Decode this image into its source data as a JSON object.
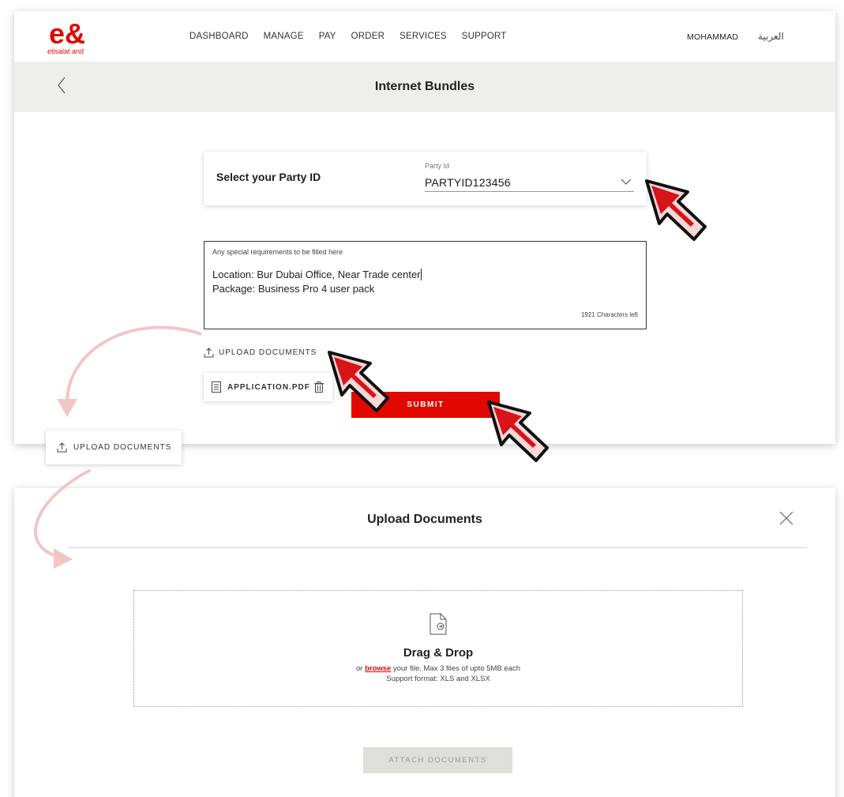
{
  "brand": {
    "logo_text": "e&",
    "sub": "etisalat and",
    "accent_color": "#e00800"
  },
  "nav": {
    "items": [
      "DASHBOARD",
      "MANAGE",
      "PAY",
      "ORDER",
      "SERVICES",
      "SUPPORT"
    ],
    "user": "MOHAMMAD",
    "language": "العربية"
  },
  "page": {
    "title": "Internet Bundles"
  },
  "party": {
    "label": "Select your Party ID",
    "field_label": "Party Id",
    "value": "PARTYID123456"
  },
  "requirements": {
    "placeholder": "Any special requirements to be filled here",
    "line1": "Location: Bur Dubai Office, Near Trade center",
    "line2": "Package: Business Pro 4 user pack",
    "chars_left": "1921 Characters left"
  },
  "upload": {
    "label": "UPLOAD DOCUMENTS",
    "file_name": "APPLICATION.PDF"
  },
  "submit": {
    "label": "SUBMIT"
  },
  "callout": {
    "label": "UPLOAD DOCUMENTS"
  },
  "modal": {
    "title": "Upload Documents",
    "drop_title": "Drag & Drop",
    "drop_or": "or",
    "drop_link": "browse",
    "drop_rest": "your file. Max 3 files of upto 5MB each",
    "drop_format": "Support format: XLS and XLSX",
    "attach_label": "ATTACH DOCUMENTS"
  },
  "icons": {
    "back": "chevron-left-icon",
    "dropdown": "chevron-down-icon",
    "upload": "upload-icon",
    "file": "document-icon",
    "trash": "trash-icon",
    "close": "close-icon",
    "drop": "file-drop-icon",
    "cursor": "cursor-arrow-icon"
  }
}
